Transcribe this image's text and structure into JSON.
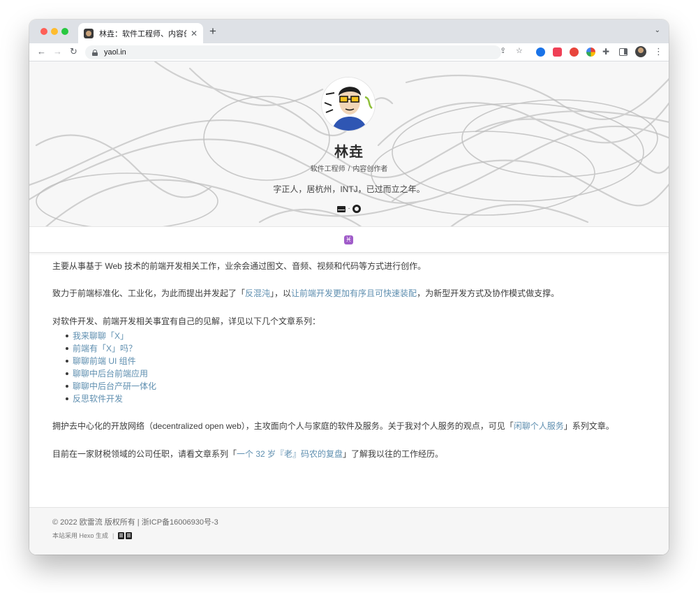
{
  "browser": {
    "tab_title": "林垚：软件工程师、内容创作者",
    "tab_close": "✕",
    "new_tab": "+",
    "tab_menu": "⌄",
    "url": "yaol.in",
    "nav_back": "←",
    "nav_forward": "→",
    "nav_reload": "↻",
    "share": "⇪",
    "star": "☆",
    "extensions_icon": "✚",
    "menu": "⋮"
  },
  "hero": {
    "name": "林垚",
    "title_1": "软件工程师",
    "title_sep": "/",
    "title_2": "内容创作者",
    "bio": "字正人，居杭州，INTJ，已过而立之年。",
    "link_sep": "·"
  },
  "zodiac": {
    "symbol": "♓"
  },
  "content": {
    "p1": "主要从事基于 Web 技术的前端开发相关工作，业余会通过图文、音频、视频和代码等方式进行创作。",
    "p2": {
      "prefix": "致力于前端标准化、工业化，为此而提出并发起了「",
      "link1": "反混沌",
      "middle": "」，以",
      "link2": "让前端开发更加有序且可快速装配",
      "suffix": "，为新型开发方式及协作模式做支撑。"
    },
    "p3": "对软件开发、前端开发相关事宜有自己的见解，详见以下几个文章系列：",
    "series": [
      "我来聊聊「X」",
      "前端有「X」吗？",
      "聊聊前端 UI 组件",
      "聊聊中后台前端应用",
      "聊聊中后台产研一体化",
      "反思软件开发"
    ],
    "p4": {
      "prefix": "拥护去中心化的开放网络（decentralized open web），主攻面向个人与家庭的软件及服务。关于我对个人服务的观点，可见「",
      "link": "闲聊个人服务",
      "suffix": "」系列文章。"
    },
    "p5": {
      "prefix": "目前在一家财税领域的公司任职，请看文章系列「",
      "link": "一个 32 岁『老』码农的复盘",
      "suffix": "」了解我以往的工作经历。"
    }
  },
  "footer": {
    "copyright": "© 2022 欧雷流 版权所有 | 浙ICP备16006930号-3",
    "generator": "本站采用 Hexo 生成",
    "sep": "|"
  },
  "colors": {
    "link": "#5f8fb0",
    "text": "#3c3c3c",
    "zodiac_badge": "#a05cc9",
    "tabstrip": "#dee1e6"
  }
}
